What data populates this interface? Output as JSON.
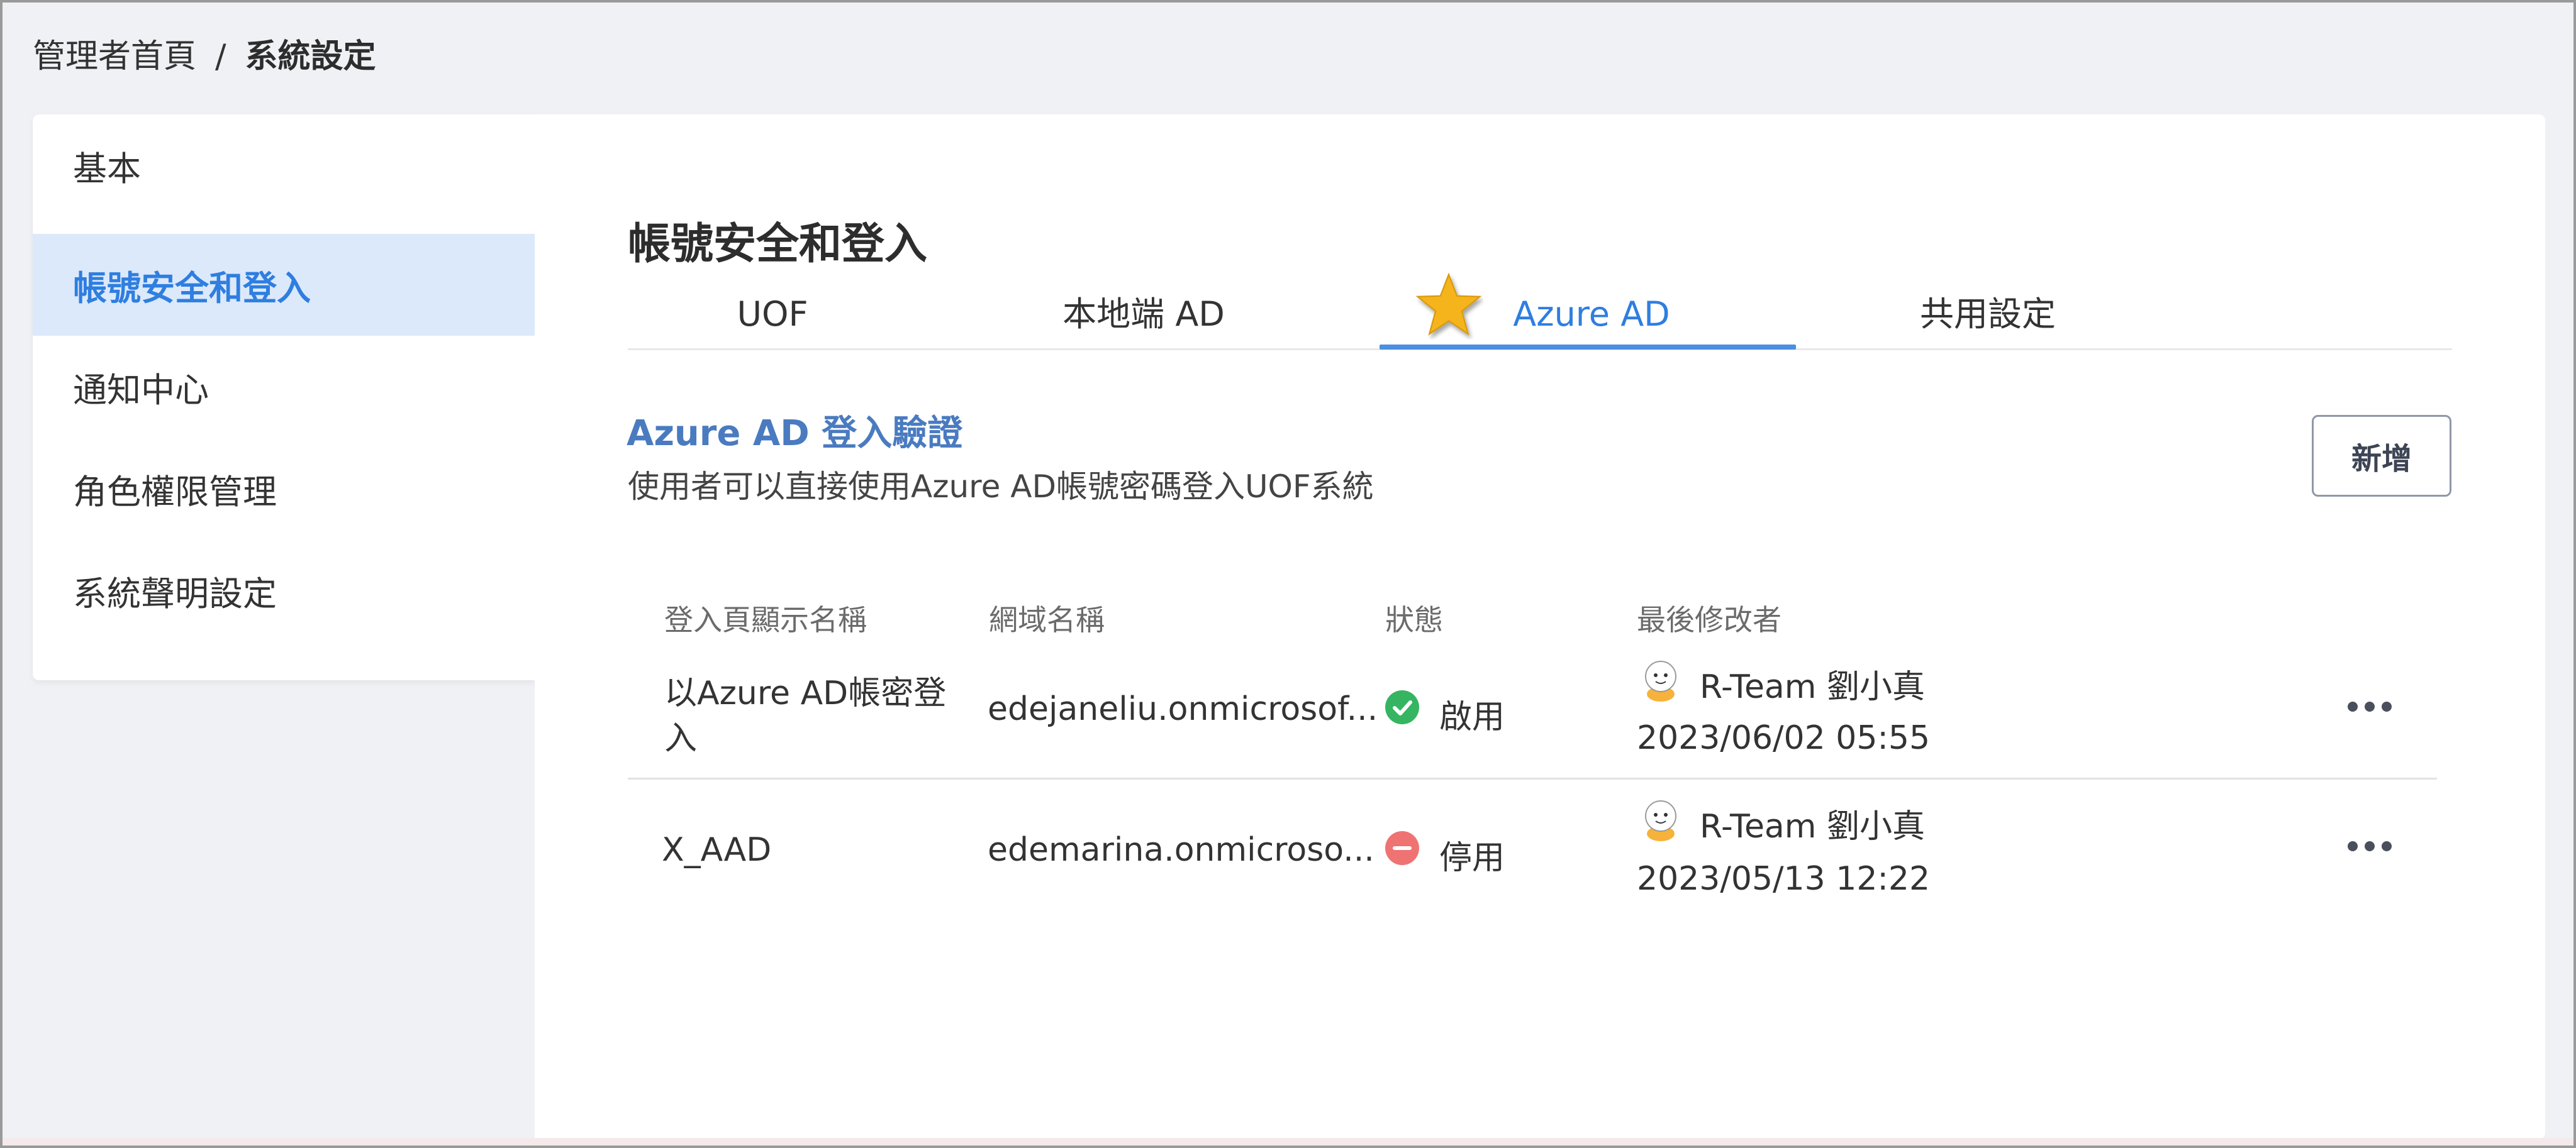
{
  "breadcrumb": {
    "home": "管理者首頁",
    "separator": "/",
    "current": "系統設定"
  },
  "sidebar": {
    "items": [
      {
        "label": "基本"
      },
      {
        "label": "帳號安全和登入"
      },
      {
        "label": "通知中心"
      },
      {
        "label": "角色權限管理"
      },
      {
        "label": "系統聲明設定"
      }
    ]
  },
  "main": {
    "title": "帳號安全和登入",
    "tabs": [
      {
        "label": "UOF"
      },
      {
        "label": "本地端 AD"
      },
      {
        "label": "Azure AD"
      },
      {
        "label": "共用設定"
      }
    ],
    "section": {
      "title": "Azure AD 登入驗證",
      "description": "使用者可以直接使用Azure AD帳號密碼登入UOF系統",
      "add_label": "新增"
    },
    "table": {
      "headers": [
        "登入頁顯示名稱",
        "網域名稱",
        "狀態",
        "最後修改者"
      ],
      "rows": [
        {
          "name_line1": "以Azure AD帳密登",
          "name_line2": "入",
          "domain": "edejaneliu.onmicrosof...",
          "status": "啟用",
          "modifier": "R-Team 劉小真",
          "modified_at": "2023/06/02 05:55"
        },
        {
          "name_line1": "X_AAD",
          "domain": "edemarina.onmicroso...",
          "status": "停用",
          "modifier": "R-Team 劉小真",
          "modified_at": "2023/05/13 12:22"
        }
      ]
    }
  },
  "colors": {
    "accent": "#2f7ee0",
    "active_bg": "#dbe9fb",
    "status_enabled": "#35b561",
    "status_disabled": "#ef7373",
    "star": "#f5b41d"
  },
  "icons": {
    "active_tab_marker": "star-icon",
    "status_enabled": "check-circle-icon",
    "status_disabled": "minus-circle-icon",
    "row_menu": "more-horizontal-icon",
    "modifier_avatar": "avatar-icon"
  }
}
